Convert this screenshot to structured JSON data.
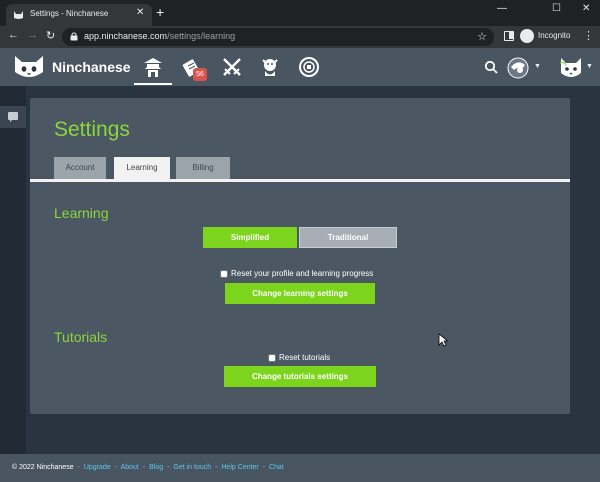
{
  "browser": {
    "tab_title": "Settings - Ninchanese",
    "tab_close": "✕",
    "new_tab": "+",
    "url_host": "app.ninchanese.com",
    "url_path": "/settings/learning",
    "profile_label": "Incognito",
    "window_minimize": "—",
    "window_maximize": "☐",
    "window_close": "✕",
    "back": "←",
    "forward": "→",
    "reload": "↻",
    "star": "☆",
    "menu": "⋮"
  },
  "app": {
    "brand": "Ninchanese",
    "notification_count": "56"
  },
  "settings": {
    "title": "Settings",
    "tabs": [
      {
        "label": "Account",
        "active": false
      },
      {
        "label": "Learning",
        "active": true
      },
      {
        "label": "Billing",
        "active": false
      }
    ],
    "learning": {
      "heading": "Learning",
      "script_options": [
        "Simplified",
        "Traditional"
      ],
      "selected_script": "Simplified",
      "reset_label": "Reset your profile and learning progress",
      "reset_checked": false,
      "submit_label": "Change learning settings"
    },
    "tutorials": {
      "heading": "Tutorials",
      "reset_label": "Reset tutorials",
      "reset_checked": false,
      "submit_label": "Change tutorials settings"
    }
  },
  "footer": {
    "copyright": "© 2022 Ninchanese",
    "separator": "-",
    "links": [
      "Upgrade",
      "About",
      "Blog",
      "Get in touch",
      "Help Center",
      "Chat"
    ]
  },
  "colors": {
    "accent_green": "#7cd41c",
    "title_green": "#8cd63a",
    "link_blue": "#5ac8e8",
    "badge_red": "#d9534f"
  },
  "icons": [
    "cat-logo-icon",
    "dojo-icon",
    "notes-icon",
    "battle-swords-icon",
    "dragon-icon",
    "coin-icon",
    "search-icon",
    "avatar-icon",
    "cat-avatar-icon",
    "chat-icon"
  ]
}
